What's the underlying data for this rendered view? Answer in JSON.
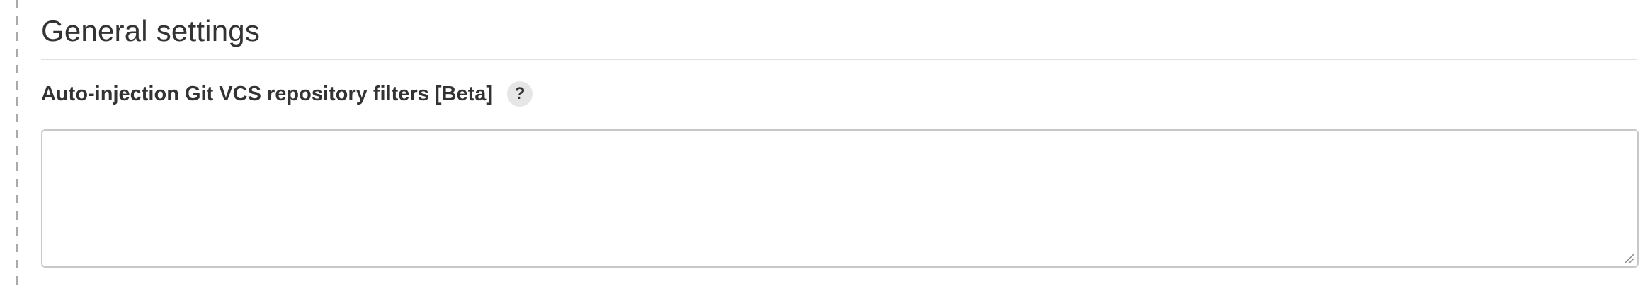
{
  "section": {
    "title": "General settings"
  },
  "field": {
    "label": "Auto-injection Git VCS repository filters [Beta]",
    "help_glyph": "?",
    "help_icon": "question-mark-icon",
    "value": "",
    "placeholder": ""
  },
  "colors": {
    "text": "#333333",
    "divider": "#e0e0e0",
    "rail": "#aaaaaa",
    "help_bg": "#e6e6e6",
    "textarea_border": "#c8c8c8"
  }
}
